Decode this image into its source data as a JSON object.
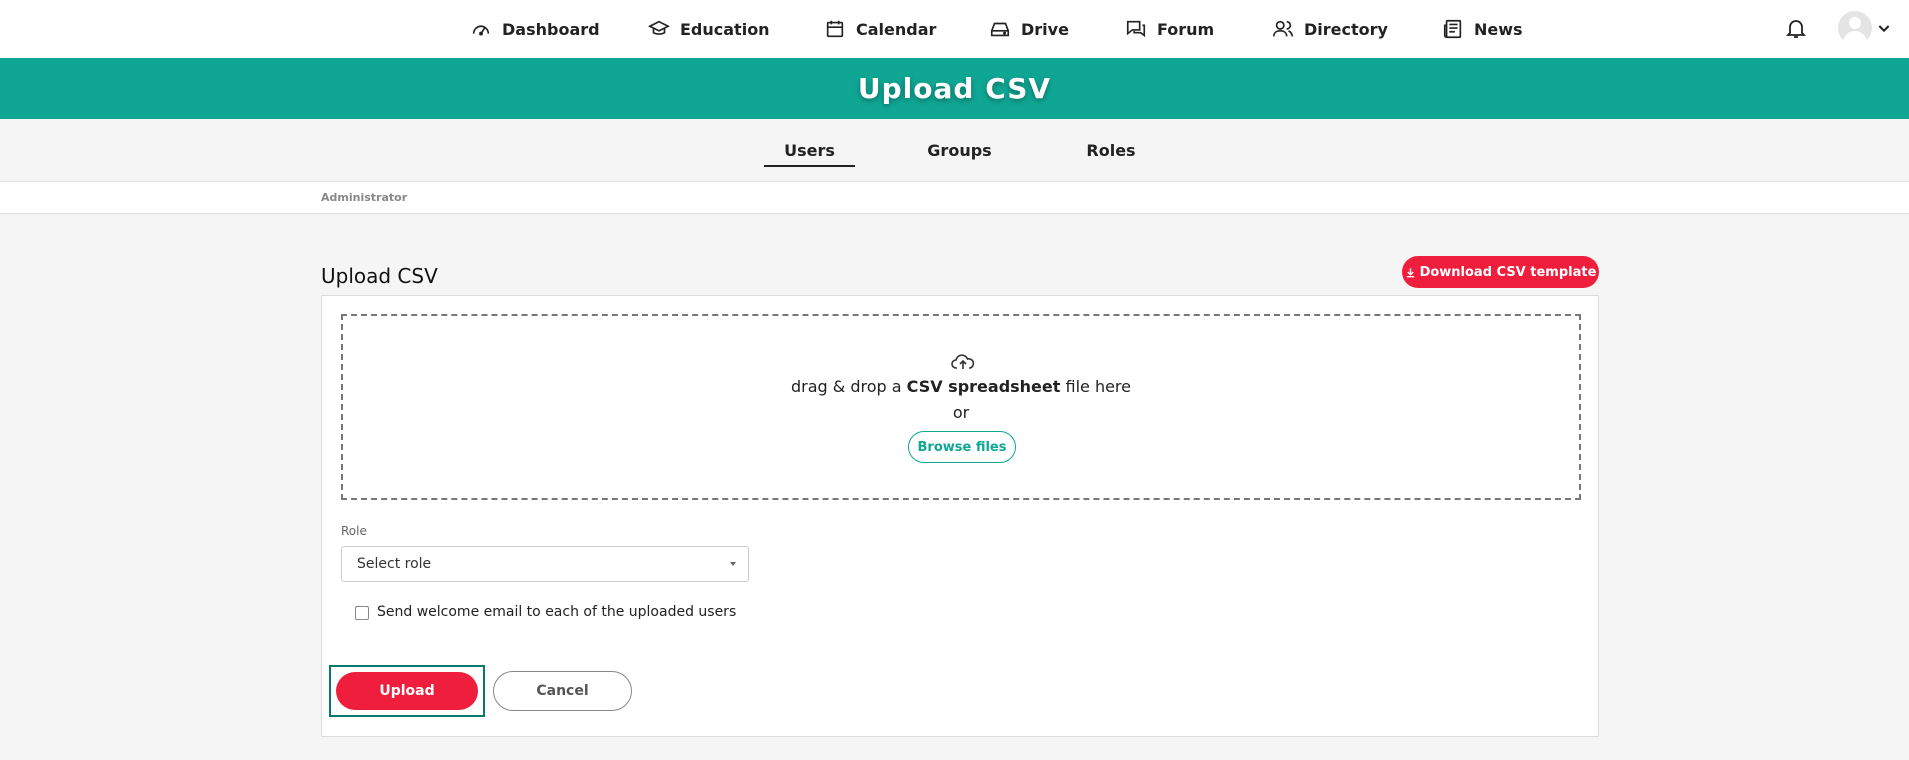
{
  "topnav": {
    "items": [
      {
        "label": "Dashboard",
        "icon": "dashboard-gauge-icon"
      },
      {
        "label": "Education",
        "icon": "graduation-cap-icon"
      },
      {
        "label": "Calendar",
        "icon": "calendar-icon"
      },
      {
        "label": "Drive",
        "icon": "drive-icon"
      },
      {
        "label": "Forum",
        "icon": "chat-bubbles-icon"
      },
      {
        "label": "Directory",
        "icon": "people-icon"
      },
      {
        "label": "News",
        "icon": "newspaper-icon"
      }
    ],
    "notifications_icon": "bell-icon",
    "account_icon": "user-avatar-icon"
  },
  "banner": {
    "title": "Upload CSV"
  },
  "tabs": [
    {
      "label": "Users",
      "active": true
    },
    {
      "label": "Groups",
      "active": false
    },
    {
      "label": "Roles",
      "active": false
    }
  ],
  "breadcrumb": {
    "label": "Administrator"
  },
  "main": {
    "title": "Upload CSV",
    "download_label": "Download CSV template",
    "dropzone": {
      "text_before": "drag & drop a ",
      "text_bold": "CSV spreadsheet",
      "text_after": " file here",
      "or": "or",
      "browse_label": "Browse files"
    },
    "role": {
      "label": "Role",
      "selected": "Select role"
    },
    "welcome_email": {
      "label": "Send welcome email to each of the uploaded users",
      "checked": false
    },
    "upload_label": "Upload",
    "cancel_label": "Cancel"
  },
  "colors": {
    "accent_teal": "#0fa794",
    "primary_red": "#ef1e3c"
  }
}
